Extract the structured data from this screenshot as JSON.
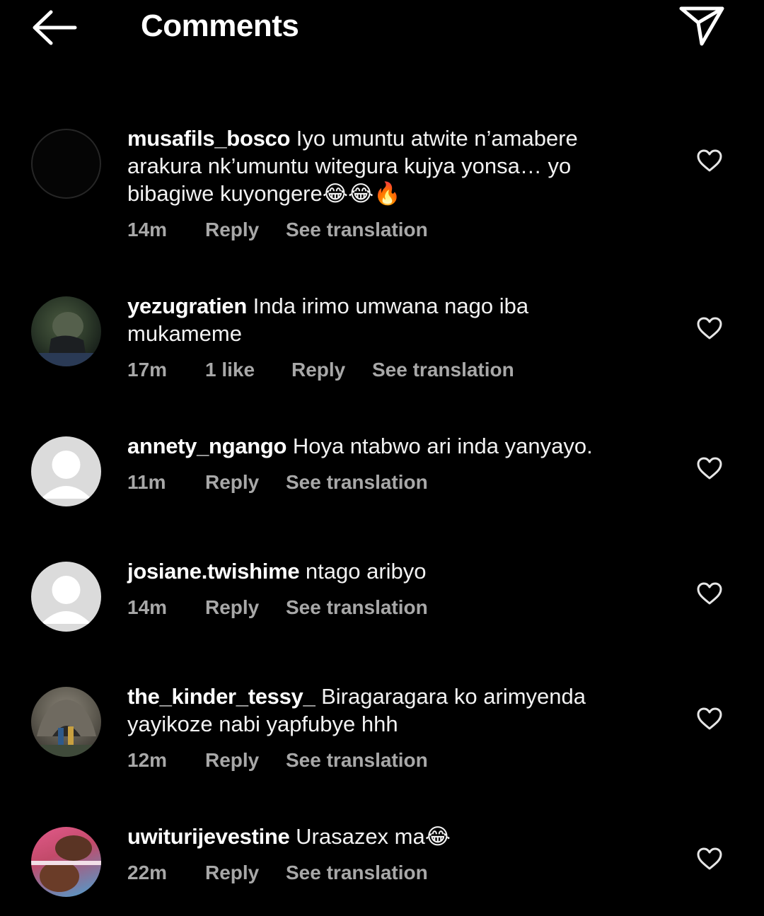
{
  "header": {
    "title": "Comments"
  },
  "comments": [
    {
      "username": "musafils_bosco",
      "text": "Iyo umuntu atwite n’amabere arakura nk’umuntu witegura kujya yonsa… yo bibagiwe kuyongere😂😂🔥",
      "time": "14m",
      "likes": "",
      "reply": "Reply",
      "translate": "See translation",
      "avatar": "dark"
    },
    {
      "username": "yezugratien",
      "text": "Inda irimo umwana nago iba mukameme",
      "time": "17m",
      "likes": "1 like",
      "reply": "Reply",
      "translate": "See translation",
      "avatar": "photo-green"
    },
    {
      "username": "annety_ngango",
      "text": "Hoya ntabwo ari inda yanyayo.",
      "time": "11m",
      "likes": "",
      "reply": "Reply",
      "translate": "See translation",
      "avatar": "default"
    },
    {
      "username": "josiane.twishime",
      "text": "ntago aribyo",
      "time": "14m",
      "likes": "",
      "reply": "Reply",
      "translate": "See translation",
      "avatar": "default"
    },
    {
      "username": "the_kinder_tessy_",
      "text": "Biragaragara ko arimyenda yayikoze nabi yapfubye hhh",
      "time": "12m",
      "likes": "",
      "reply": "Reply",
      "translate": "See translation",
      "avatar": "photo-rock"
    },
    {
      "username": "uwiturijevestine",
      "text": "Urasazex ma😂",
      "time": "22m",
      "likes": "",
      "reply": "Reply",
      "translate": "See translation",
      "avatar": "photo-pink"
    }
  ]
}
